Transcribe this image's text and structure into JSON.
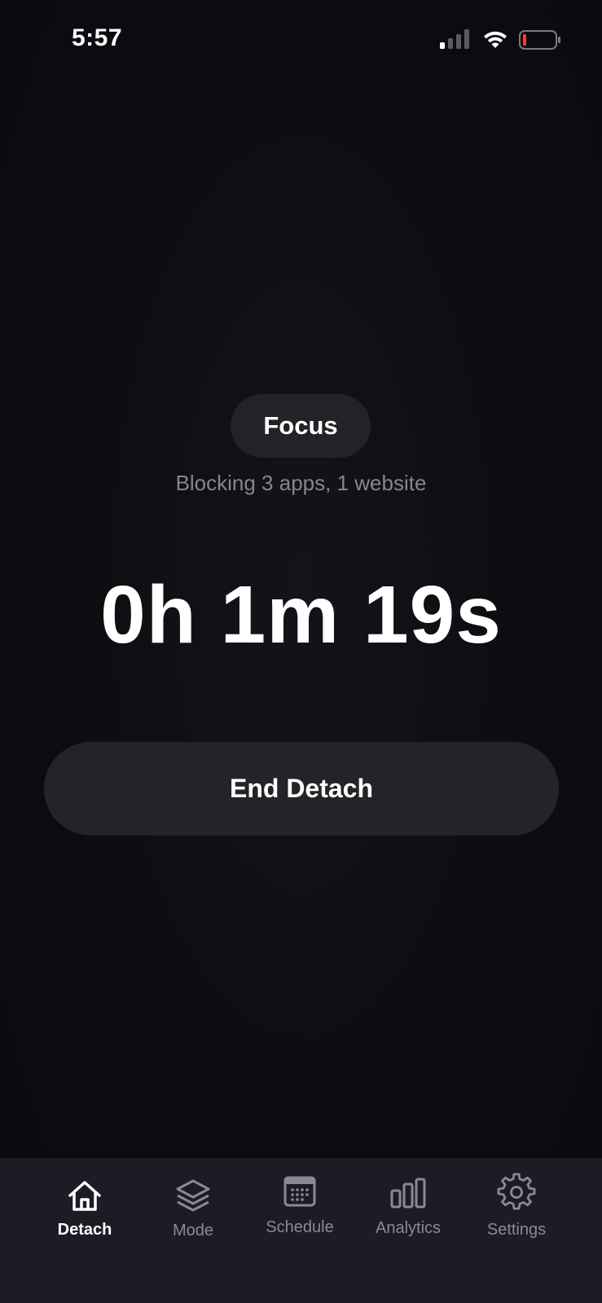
{
  "status_bar": {
    "time": "5:57",
    "battery_color": "#ff3b30"
  },
  "session": {
    "mode_label": "Focus",
    "blocking_text": "Blocking 3 apps, 1 website",
    "timer": "0h 1m 19s",
    "end_button_label": "End Detach"
  },
  "tab_bar": {
    "tabs": [
      {
        "label": "Detach",
        "icon": "home-icon",
        "active": true
      },
      {
        "label": "Mode",
        "icon": "layers-icon",
        "active": false
      },
      {
        "label": "Schedule",
        "icon": "calendar-icon",
        "active": false
      },
      {
        "label": "Analytics",
        "icon": "bar-chart-icon",
        "active": false
      },
      {
        "label": "Settings",
        "icon": "gear-icon",
        "active": false
      }
    ]
  },
  "colors": {
    "background": "#0c0c10",
    "surface": "#242428",
    "tab_bar": "#1c1c26",
    "muted_text": "#86868c"
  }
}
